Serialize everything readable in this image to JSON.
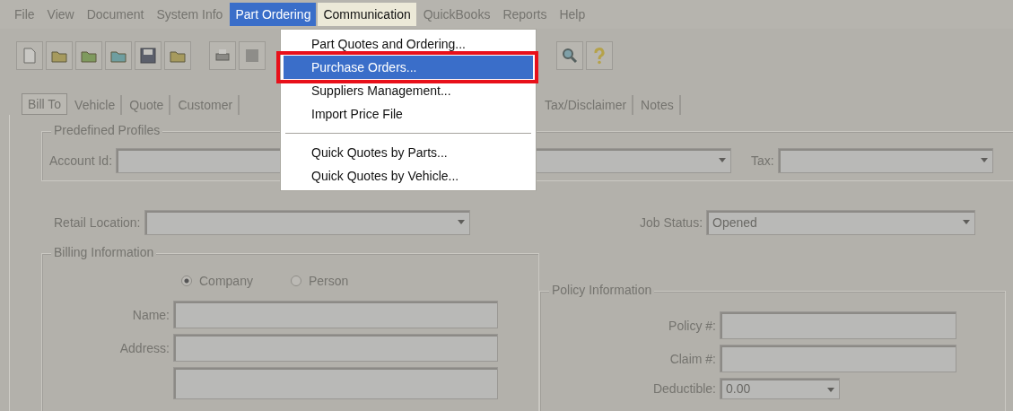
{
  "menu_bar": [
    {
      "label": "File",
      "selected": false,
      "lit": false
    },
    {
      "label": "View",
      "selected": false,
      "lit": false
    },
    {
      "label": "Document",
      "selected": false,
      "lit": false
    },
    {
      "label": "System Info",
      "selected": false,
      "lit": false
    },
    {
      "label": "Part Ordering",
      "selected": true,
      "lit": true
    },
    {
      "label": "Communication",
      "selected": false,
      "lit": true
    },
    {
      "label": "QuickBooks",
      "selected": false,
      "lit": false
    },
    {
      "label": "Reports",
      "selected": false,
      "lit": false
    },
    {
      "label": "Help",
      "selected": false,
      "lit": false
    }
  ],
  "dropdown_menu": [
    {
      "kind": "item",
      "label": "Part Quotes and Ordering...",
      "selected": false
    },
    {
      "kind": "item",
      "label": "Purchase Orders...",
      "selected": true
    },
    {
      "kind": "item",
      "label": "Suppliers Management...",
      "selected": false
    },
    {
      "kind": "item",
      "label": "Import Price File",
      "selected": false
    },
    {
      "kind": "separator"
    },
    {
      "kind": "item",
      "label": "Quick Quotes by Parts...",
      "selected": false
    },
    {
      "kind": "item",
      "label": "Quick Quotes by Vehicle...",
      "selected": false
    }
  ],
  "tabs": [
    {
      "label": "Bill To",
      "selected": true
    },
    {
      "label": "Vehicle",
      "selected": false
    },
    {
      "label": "Quote",
      "selected": false
    },
    {
      "label": "Customer",
      "selected": false
    },
    {
      "label": "Tax/Disclaimer",
      "selected": false
    },
    {
      "label": "Notes",
      "selected": false
    }
  ],
  "predefined_profiles": {
    "title": "Predefined Profiles",
    "account_id_label": "Account Id:",
    "tax_label": "Tax:"
  },
  "retail_location_label": "Retail Location:",
  "job_status": {
    "label": "Job Status:",
    "value": "Opened"
  },
  "billing_information": {
    "title": "Billing Information",
    "options": [
      {
        "label": "Company",
        "selected": true
      },
      {
        "label": "Person",
        "selected": false
      }
    ],
    "name_label": "Name:",
    "address_label": "Address:"
  },
  "policy_information": {
    "title": "Policy Information",
    "policy_label": "Policy #:",
    "claim_label": "Claim #:",
    "deductible_label": "Deductible:",
    "deductible_value": "0.00"
  }
}
